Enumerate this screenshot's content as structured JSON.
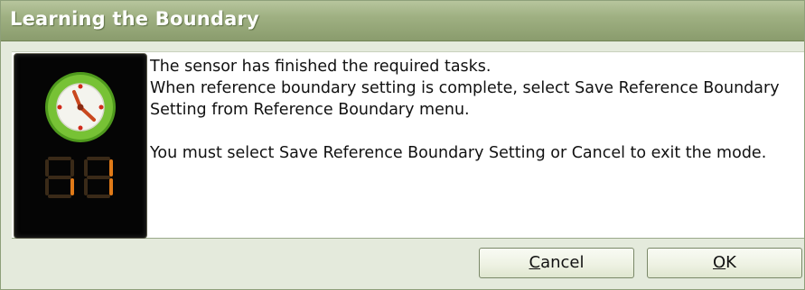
{
  "dialog": {
    "title": "Learning the Boundary"
  },
  "message": {
    "line1": "The sensor has finished the required tasks.",
    "line2": "When reference boundary setting is complete, select Save Reference Boundary Setting from Reference Boundary menu.",
    "line3": "You must select Save Reference Boundary Setting or Cancel to exit the mode."
  },
  "buttons": {
    "cancel_accel": "C",
    "cancel_rest": "ancel",
    "ok_accel": "O",
    "ok_rest": "K"
  },
  "icons": {
    "clock": "clock-icon",
    "digits": "seven-segment-digits-icon"
  },
  "colors": {
    "title_bar": "#9fb082",
    "dialog_bg": "#e4eadc",
    "clock_green": "#6fbf2b",
    "digit_orange": "#e07a18"
  }
}
